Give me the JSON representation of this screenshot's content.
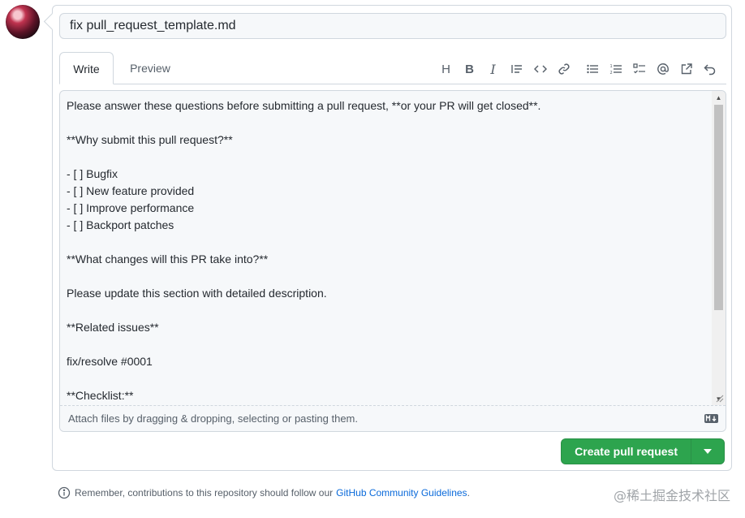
{
  "title_input": {
    "value": "fix pull_request_template.md"
  },
  "tabs": {
    "write": "Write",
    "preview": "Preview"
  },
  "toolbar": {
    "heading": "H",
    "bold": "B",
    "italic": "I"
  },
  "editor": {
    "lines": [
      "Please answer these questions before submitting a pull request, **or your PR will get closed**.",
      "",
      "**Why submit this pull request?**",
      "",
      "- [ ] Bugfix",
      "- [ ] New feature provided",
      "- [ ] Improve performance",
      "- [ ] Backport patches",
      "",
      "**What changes will this PR take into?**",
      "",
      "Please update this section with detailed description.",
      "",
      "**Related issues**",
      "",
      "fix/resolve #0001",
      "",
      "**Checklist:**"
    ],
    "attach_hint": "Attach files by dragging & dropping, selecting or pasting them."
  },
  "submit": {
    "label": "Create pull request"
  },
  "footer": {
    "note": "Remember, contributions to this repository should follow our",
    "link": "GitHub Community Guidelines",
    "suffix": "."
  },
  "watermark": "@稀土掘金技术社区",
  "colors": {
    "accent": "#2da44e",
    "link": "#0969da",
    "border": "#d0d7de"
  }
}
